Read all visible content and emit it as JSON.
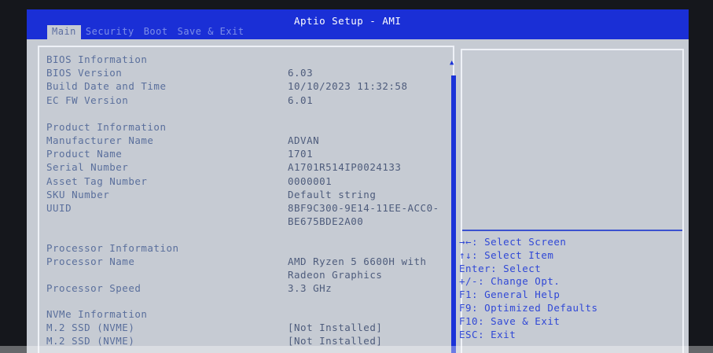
{
  "header": {
    "title": "Aptio Setup - AMI",
    "tabs": [
      "Main",
      "Security",
      "Boot",
      "Save & Exit"
    ]
  },
  "bios": {
    "heading": "BIOS Information",
    "version_label": "BIOS Version",
    "version_value": "6.03",
    "build_label": "Build Date and Time",
    "build_value": "10/10/2023 11:32:58",
    "ec_label": "EC FW Version",
    "ec_value": "6.01"
  },
  "product": {
    "heading": "Product Information",
    "manufacturer_label": "Manufacturer Name",
    "manufacturer_value": "ADVAN",
    "name_label": "Product Name",
    "name_value": "1701",
    "serial_label": "Serial Number",
    "serial_value": "A1701R514IP0024133",
    "asset_label": "Asset Tag Number",
    "asset_value": "0000001",
    "sku_label": "SKU Number",
    "sku_value": "Default string",
    "uuid_label": "UUID",
    "uuid_value_line1": "8BF9C300-9E14-11EE-ACC0-",
    "uuid_value_line2": "BE675BDE2A00"
  },
  "processor": {
    "heading": "Processor Information",
    "name_label": "Processor Name",
    "name_value_line1": "AMD Ryzen 5 6600H with",
    "name_value_line2": "Radeon Graphics",
    "speed_label": "Processor Speed",
    "speed_value": "3.3 GHz"
  },
  "nvme": {
    "heading": "NVMe Information",
    "ssd1_label": "M.2 SSD (NVME)",
    "ssd1_value": "[Not Installed]",
    "ssd2_label": "M.2 SSD (NVME)",
    "ssd2_value": "[Not Installed]"
  },
  "help": [
    "→←: Select Screen",
    "↑↓: Select Item",
    "Enter: Select",
    "+/-: Change Opt.",
    "F1: General Help",
    "F9: Optimized Defaults",
    "F10: Save & Exit",
    "ESC: Exit"
  ]
}
